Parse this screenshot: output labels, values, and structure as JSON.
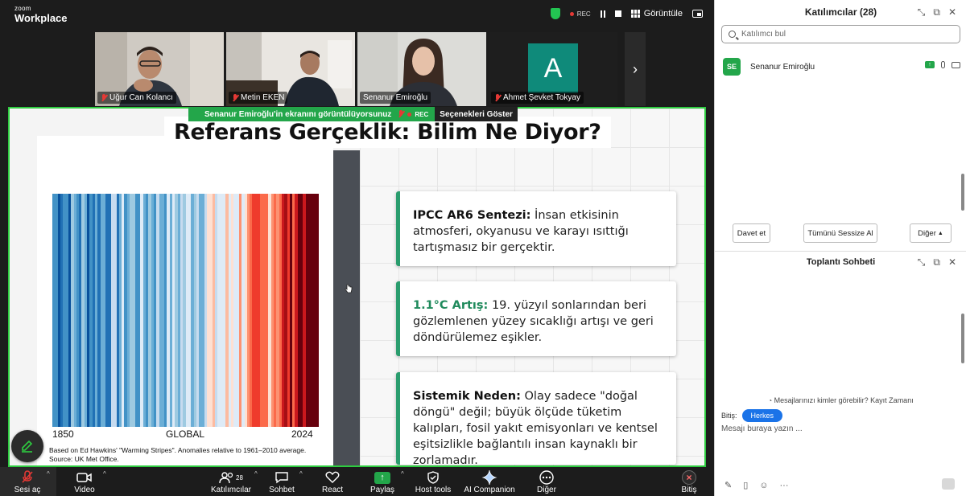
{
  "app": {
    "logo_small": "zoom",
    "logo_big": "Workplace",
    "rec_label": "REC",
    "view_label": "Görüntüle"
  },
  "colors": {
    "accent_green": "#23a64a",
    "share_border": "#2ecc40",
    "chat_pill": "#1a73e8",
    "end_red": "#e53935"
  },
  "video_tiles": [
    {
      "name": "Uğur Can Kolancı",
      "muted": true
    },
    {
      "name": "Metin EKEN",
      "muted": true
    },
    {
      "name": "Senanur Emiroğlu",
      "muted": false
    },
    {
      "name": "Ahmet Şevket Tokyay",
      "muted": true,
      "avatar_letter": "A"
    }
  ],
  "share_banner": {
    "text": "Senanur Emiroğlu'in ekranını görüntülüyorsunuz",
    "rec": "REC",
    "options": "Seçenekleri Göster"
  },
  "slide": {
    "title": "Referans Gerçeklik: Bilim Ne Diyor?",
    "chart_label_left": "1850",
    "chart_label_center": "GLOBAL",
    "chart_label_right": "2024",
    "caption_line1": "Based on Ed Hawkins' \"Warming Stripes\". Anomalies relative to 1961–2010 average.",
    "caption_line2": "Source: UK Met Office.",
    "boxes": [
      {
        "head": "IPCC AR6 Sentezi:",
        "body": " İnsan etkisinin atmosferi, okyanusu ve karayı ısıttığı tartışmasız bir gerçektir."
      },
      {
        "head": "1.1°C Artış:",
        "body": " 19. yüzyıl sonlarından beri gözlemlenen yüzey sıcaklığı artışı ve geri döndürülemez eşikler."
      },
      {
        "head": "Sistemik Neden:",
        "body": " Olay sadece \"doğal döngü\" değil; büyük ölçüde tüketim kalıpları, fosil yakıt emisyonları ve kentsel eşitsizlikle bağlantılı insan kaynaklı bir zorlamadır."
      }
    ]
  },
  "toolbar": {
    "audio": "Sesi aç",
    "video": "Video",
    "participants": "Katılımcılar",
    "participants_count": "28",
    "chat": "Sohbet",
    "react": "React",
    "share": "Paylaş",
    "host_tools": "Host tools",
    "ai": "AI Companion",
    "more": "Diğer",
    "end": "Bitiş"
  },
  "participants_panel": {
    "title": "Katılımcılar (28)",
    "search_placeholder": "Katılımcı bul",
    "participant": {
      "initials": "SE",
      "name": "Senanur Emiroğlu"
    },
    "invite": "Davet et",
    "mute_all": "Tümünü Sessize Al",
    "more": "Diğer"
  },
  "chat_panel": {
    "title": "Toplantı Sohbeti",
    "note": "Mesajlarınızı kimler görebilir? Kayıt Zamanı",
    "to_label": "Bitiş:",
    "to_value": "Herkes",
    "input_placeholder": "Mesajı buraya yazın ..."
  }
}
